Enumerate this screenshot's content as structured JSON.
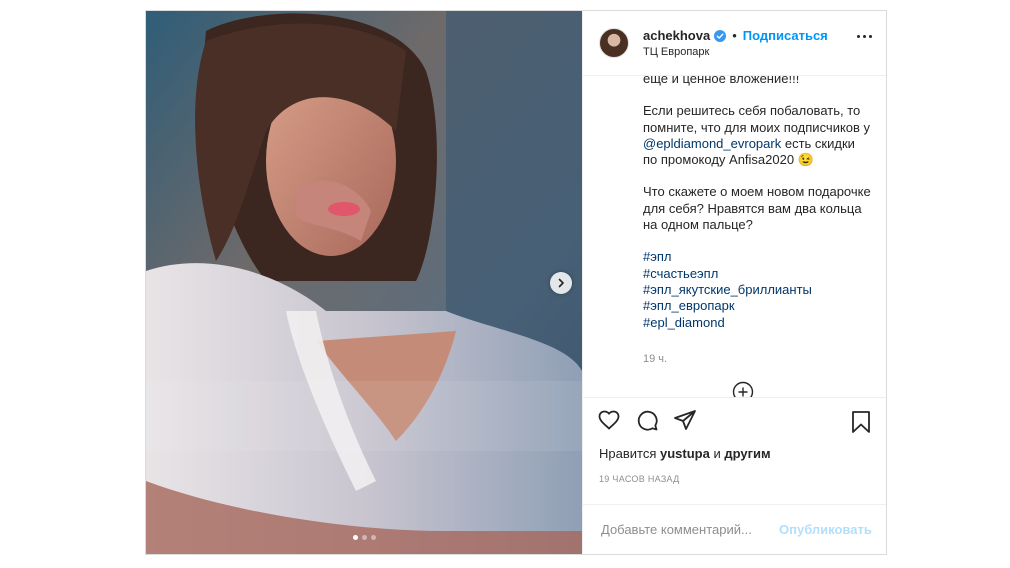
{
  "post": {
    "author": {
      "username": "achekhova",
      "verified": true,
      "separator": "•",
      "follow_label": "Подписаться",
      "location": "ТЦ Европарк",
      "avatar_icon": "profile-photo"
    },
    "media": {
      "slide_count": 3,
      "active_slide": 1,
      "next_icon": "chevron-right-icon"
    },
    "caption": {
      "line_1": "еще и ценное вложение!!!",
      "para_2_before": "Если решитесь себя побаловать, то помните, что для моих подписчиков у ",
      "mention": "@epldiamond_evropark",
      "para_2_after": " есть скидки по промокоду Anfisa2020 😉",
      "para_3": "Что скажете о моем новом подарочке для себя? Нравятся вам два кольца на одном пальце?",
      "hashtags": [
        "#эпл",
        "#счастьеэпл",
        "#эпл_якутские_бриллианты",
        "#эпл_европарк",
        "#epl_diamond"
      ],
      "relative_time": "19 ч."
    },
    "likes": {
      "prefix": "Нравится",
      "user": "yustupa",
      "conjunction": "и",
      "others": "другим"
    },
    "timestamp": "19 ЧАСОВ НАЗАД",
    "comment": {
      "placeholder": "Добавьте комментарий...",
      "value": "",
      "publish_label": "Опубликовать"
    }
  },
  "colors": {
    "accent": "#0095f6",
    "link": "#00376b",
    "muted": "#8e8e8e",
    "publish_disabled": "#b2dffc",
    "border": "#dbdbdb"
  }
}
